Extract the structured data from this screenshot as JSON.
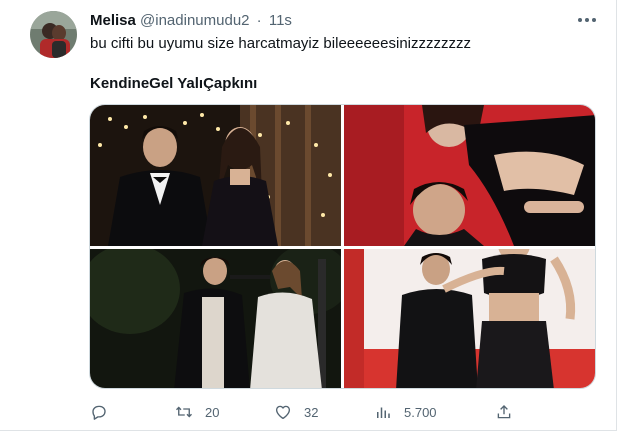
{
  "tweet": {
    "author_name": "Melisa",
    "handle": "@inadinumudu2",
    "separator": "·",
    "time": "11s",
    "text": "bu cifti bu uyumu size harcatmayiz bileeeeeesinizzzzzzzz",
    "hashtags": "KendineGel YalıÇapkını"
  },
  "media": {
    "images": [
      {
        "icon": "couple-formal-night-photo"
      },
      {
        "icon": "couple-red-backdrop-photo"
      },
      {
        "icon": "couple-street-night-photo"
      },
      {
        "icon": "couple-studio-red-photo"
      }
    ]
  },
  "actions": {
    "reply": {
      "icon": "reply-icon",
      "count": ""
    },
    "retweet": {
      "icon": "retweet-icon",
      "count": "20"
    },
    "like": {
      "icon": "like-icon",
      "count": "32"
    },
    "views": {
      "icon": "views-icon",
      "count": "5.700"
    },
    "share": {
      "icon": "share-icon"
    }
  },
  "colors": {
    "text_primary": "#0f1419",
    "text_secondary": "#536471",
    "border": "#cfd9de"
  }
}
